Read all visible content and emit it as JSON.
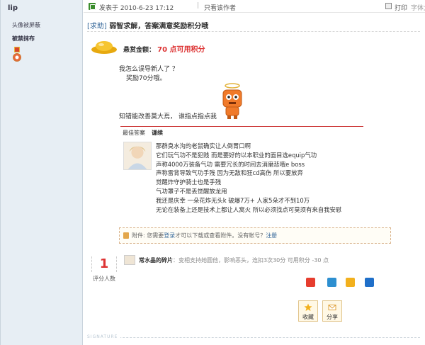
{
  "sidebar": {
    "username": "lip",
    "shield_avatar": "头像被屏蔽",
    "banned_label": "被禁抹布"
  },
  "toolbar": {
    "posted_at": "发表于 2010-6-23 17:12",
    "separator": "|",
    "author_only": "只看该作者",
    "print": "打印",
    "font_size": "字体大"
  },
  "post": {
    "tag": "[求助]",
    "title": "弱智求解，答案满意奖励积分哦",
    "reward_label": "悬赏金额：",
    "reward_amount": "70 点可用积分",
    "body_line1": "我怎么误导新人了 ？",
    "body_line2": "奖励70分哦。",
    "body_line3": "知错能改善莫大焉，  谁指点指点我"
  },
  "best_answer": {
    "label": "最佳答案",
    "author": "谦续",
    "lines": [
      "那群臭水沟的老鼠确实让人倒胃口啊",
      "它们玩气功不是犯贱    而是要好的以本职业的面目选equip气功",
      "声称4000万装备气功   需要冗长的时间去消磨悲哦e   boss",
      "声称雷背导致气功手残    因为无敌和狂cd高伤   所以要放弃",
      "觉醒炸守护骑士也是手残",
      "气功罩子不是丢觉醒放龙用",
      "我还是庆幸   一朵花炸无头k  破爆7万+      人家5朵才不到10万",
      "无论在装备上还是技术上都让人窝火  所以必须找点可莫须有来自我安慰"
    ]
  },
  "attachment": {
    "prefix": "附件: 您需要",
    "login": "登录",
    "middle": "才可以下载或查看附件。没有帐号？",
    "register": "注册"
  },
  "rating": {
    "count": "1",
    "label": "评分人数",
    "rater_name": "常水晶的碎片",
    "rater_reason": "：变相支持她圆他，影响恶头，连扣3次30分 可用积分  -30 点"
  },
  "actions": {
    "favorite": "收藏",
    "share": "分享"
  },
  "signature": {
    "label": "SIGNATURE"
  },
  "icons": {
    "share_weibo_color": "#e63d2e",
    "share_qq_color": "#2d8fd0",
    "share_qzone_color": "#f2b01d",
    "share_renren_color": "#1f6fc9",
    "accent_red": "#dd3333",
    "link_blue": "#336699"
  }
}
